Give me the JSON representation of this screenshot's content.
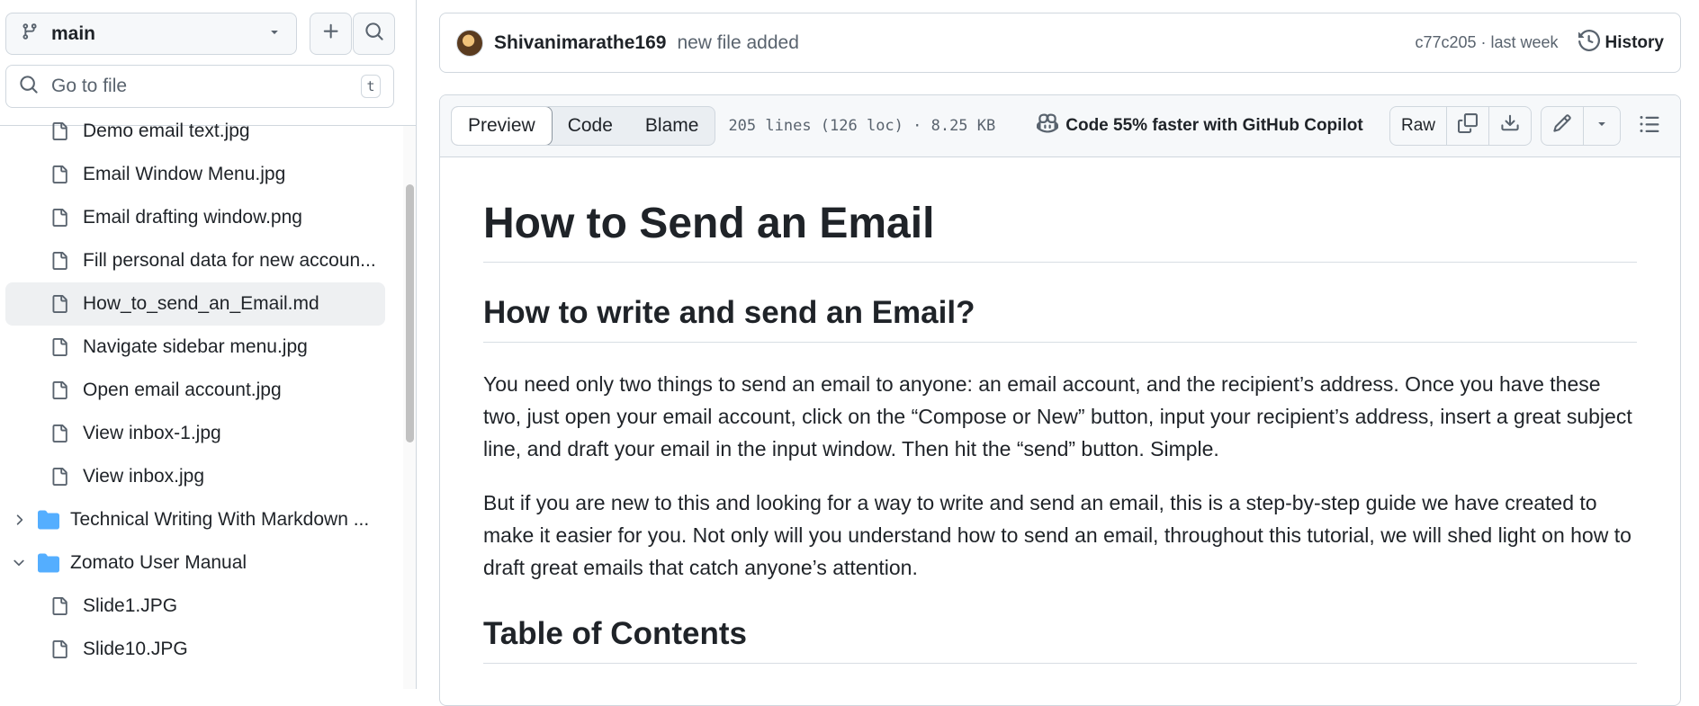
{
  "sidebar": {
    "branch": {
      "label": "main"
    },
    "goto": {
      "placeholder": "Go to file",
      "shortcut": "t"
    },
    "items": [
      {
        "type": "file",
        "label": "Demo email text.jpg",
        "active": false,
        "indent": 1
      },
      {
        "type": "file",
        "label": "Email Window Menu.jpg",
        "active": false,
        "indent": 1
      },
      {
        "type": "file",
        "label": "Email drafting window.png",
        "active": false,
        "indent": 1
      },
      {
        "type": "file",
        "label": "Fill personal data for new accoun...",
        "active": false,
        "indent": 1
      },
      {
        "type": "file",
        "label": "How_to_send_an_Email.md",
        "active": true,
        "indent": 1
      },
      {
        "type": "file",
        "label": "Navigate sidebar menu.jpg",
        "active": false,
        "indent": 1
      },
      {
        "type": "file",
        "label": "Open email account.jpg",
        "active": false,
        "indent": 1
      },
      {
        "type": "file",
        "label": "View inbox-1.jpg",
        "active": false,
        "indent": 1
      },
      {
        "type": "file",
        "label": "View inbox.jpg",
        "active": false,
        "indent": 1
      },
      {
        "type": "folder",
        "label": "Technical Writing With Markdown ...",
        "expanded": false,
        "indent": 0
      },
      {
        "type": "folder",
        "label": "Zomato User Manual",
        "expanded": true,
        "indent": 0
      },
      {
        "type": "file",
        "label": "Slide1.JPG",
        "active": false,
        "indent": 1
      },
      {
        "type": "file",
        "label": "Slide10.JPG",
        "active": false,
        "indent": 1
      }
    ]
  },
  "commit": {
    "author": "Shivanimarathe169",
    "message": "new file added",
    "sha_time": "c77c205 · last week",
    "history_label": "History"
  },
  "file_header": {
    "tabs": [
      "Preview",
      "Code",
      "Blame"
    ],
    "active_tab": 0,
    "meta": "205 lines (126 loc) · 8.25 KB",
    "copilot": "Code 55% faster with GitHub Copilot",
    "raw_label": "Raw"
  },
  "content": {
    "h1": "How to Send an Email",
    "h2a": "How to write and send an Email?",
    "p1": "You need only two things to send an email to anyone: an email account, and the recipient’s address. Once you have these two, just open your email account, click on the “Compose or New” button, input your recipient’s address, insert a great subject line, and draft your email in the input window. Then hit the “send” button. Simple.",
    "p2": "But if you are new to this and looking for a way to write and send an email, this is a step-by-step guide we have created to make it easier for you. Not only will you understand how to send an email, throughout this tutorial, we will shed light on how to draft great emails that catch anyone’s attention.",
    "h2b": "Table of Contents"
  },
  "colors": {
    "folder": "#54aeff",
    "border": "#d0d7de",
    "muted": "#59636e",
    "active_bg": "#eef0f2"
  }
}
